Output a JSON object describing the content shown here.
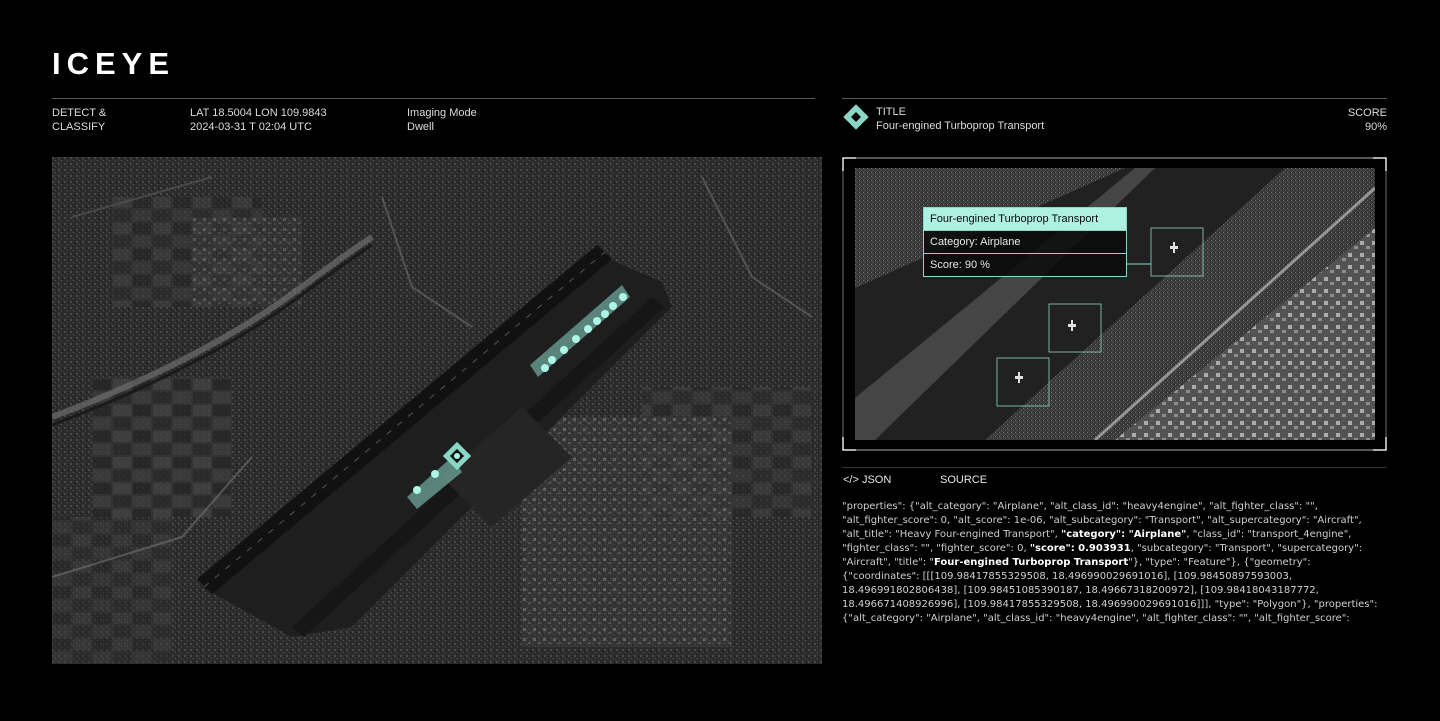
{
  "brand": "ICEYE",
  "header": {
    "mode_line1": "DETECT &",
    "mode_line2": "CLASSIFY",
    "coords": "LAT 18.5004 LON 109.9843",
    "datetime": "2024-03-31 T 02:04 UTC",
    "imaging_label": "Imaging Mode",
    "imaging_value": "Dwell"
  },
  "detection": {
    "title_label": "TITLE",
    "title_value": "Four-engined Turboprop Transport",
    "score_label": "SCORE",
    "score_value": "90%"
  },
  "callout": {
    "title": "Four-engined Turboprop Transport",
    "category": "Category: Airplane",
    "score": "Score: 90 %"
  },
  "tabs": {
    "json": "</> JSON",
    "source": "SOURCE"
  },
  "json_text": {
    "p1": "\"properties\": {\"alt_category\": \"Airplane\", \"alt_class_id\": \"heavy4engine\", \"alt_fighter_class\": \"\", \"alt_fighter_score\": 0, \"alt_score\": 1e-06, \"alt_subcategory\": \"Transport\", \"alt_supercategory\": \"Aircraft\", \"alt_title\": \"Heavy Four-engined Transport\", ",
    "k1": "\"category\": \"Airplane\"",
    "p2": ", \"class_id\": \"transport_4engine\", \"fighter_class\": \"\", \"fighter_score\": 0, ",
    "k2": "\"score\": 0.903931",
    "p3": ", \"subcategory\": \"Transport\", \"supercategory\": \"Aircraft\", \"title\": \"",
    "k3": "Four-engined Turboprop Transport",
    "p4": "\"}, \"type\": \"Feature\"}, {\"geometry\": {\"coordinates\": [[[109.98417855329508, 18.496990029691016], [109.98450897593003, 18.496991802806438], [109.98451085390187, 18.49667318200972], [109.98418043187772, 18.496671408926996], [109.98417855329508, 18.496990029691016]]], \"type\": \"Polygon\"}, \"properties\": {\"alt_category\": \"Airplane\", \"alt_class_id\": \"heavy4engine\", \"alt_fighter_class\": \"\", \"alt_fighter_score\":"
  },
  "colors": {
    "accent": "#8ad7c8",
    "callout_head": "#aef0e2",
    "background": "#000000"
  },
  "icons": {
    "detection": "diamond-target-icon",
    "json": "code-icon"
  }
}
